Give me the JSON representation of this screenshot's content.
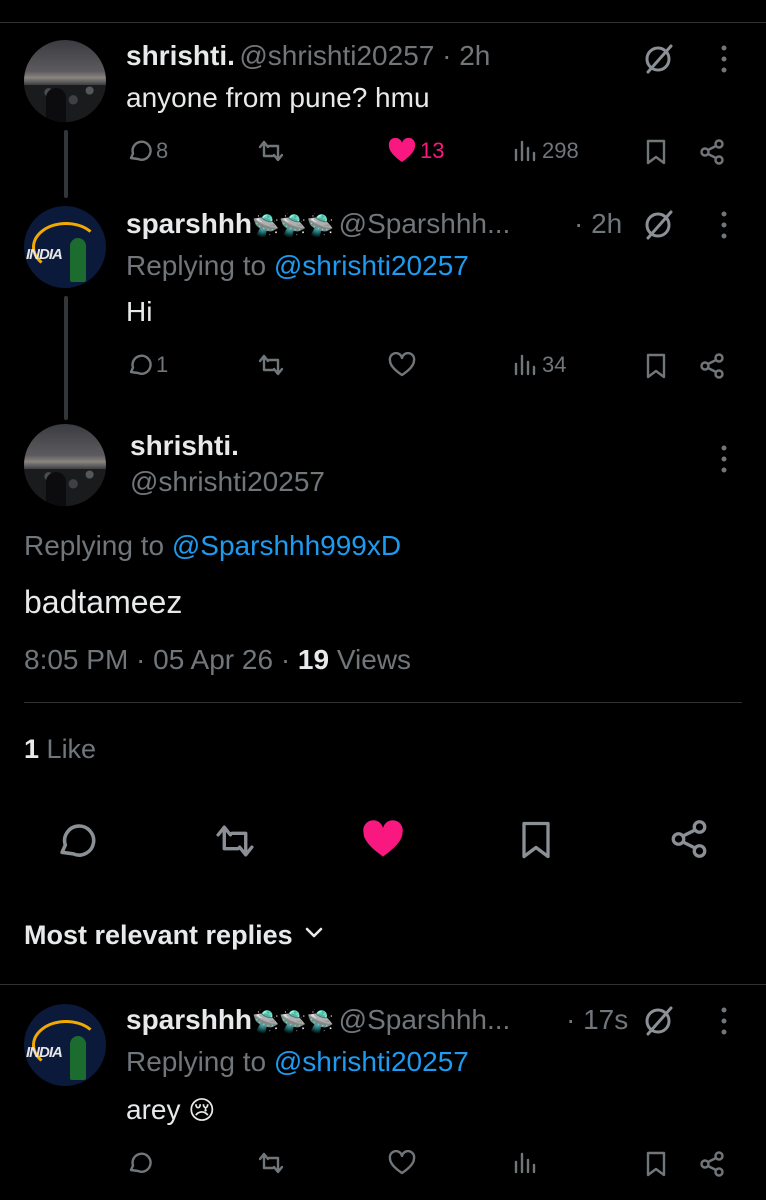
{
  "thread": [
    {
      "name": "shrishti.",
      "meta": "@shrishti20257 · 2h",
      "text": "anyone from pune? hmu",
      "counts": {
        "reply": "8",
        "like": "13",
        "views": "298"
      },
      "liked": true
    },
    {
      "name": "sparshhh",
      "name_emoji": "🛸🛸🛸",
      "meta": "@Sparshhh...",
      "time": "· 2h",
      "replying_prefix": "Replying to",
      "replying_to": "@shrishti20257",
      "text": "Hi",
      "counts": {
        "reply": "1",
        "views": "34"
      },
      "liked": false
    }
  ],
  "main_tweet": {
    "name": "shrishti.",
    "handle": "@shrishti20257",
    "replying_prefix": "Replying to",
    "replying_to": "@Sparshhh999xD",
    "text": "badtameez",
    "timestamp": "8:05 PM · 05 Apr 26 ·",
    "views_count": "19",
    "views_label": "Views",
    "likes_count": "1",
    "likes_label": "Like"
  },
  "replies_section": {
    "label": "Most relevant replies"
  },
  "reply": {
    "name": "sparshhh",
    "name_emoji": "🛸🛸🛸",
    "meta": "@Sparshhh...",
    "time": "· 17s",
    "replying_prefix": "Replying to",
    "replying_to": "@shrishti20257",
    "text": "arey",
    "text_emoji": "😢"
  },
  "colors": {
    "background": "#000000",
    "text": "#e7e9ea",
    "muted": "#71767b",
    "accent": "#1d9bf0",
    "like": "#f91880",
    "divider": "#2f3336"
  },
  "icons": [
    "reply-icon",
    "retweet-icon",
    "heart-icon",
    "views-icon",
    "bookmark-icon",
    "share-icon",
    "grok-icon",
    "more-icon",
    "chevron-down-icon"
  ]
}
